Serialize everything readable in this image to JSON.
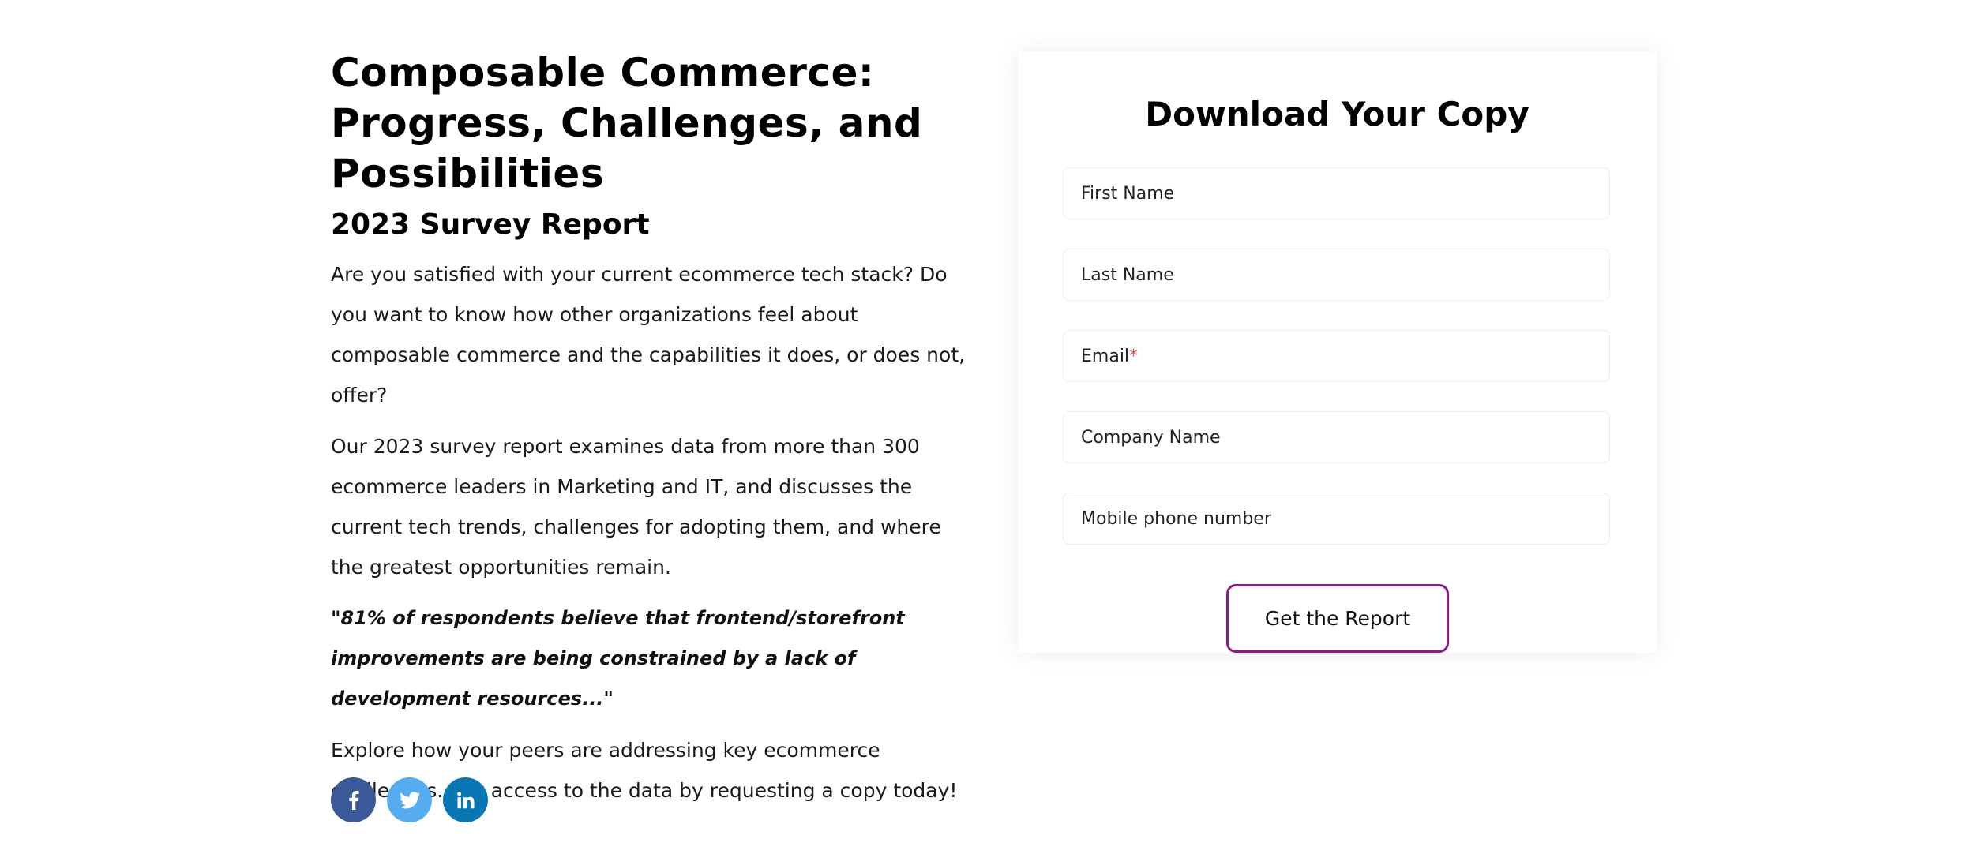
{
  "article": {
    "title": "Composable Commerce: Progress, Challenges, and Possibilities",
    "subtitle": "2023 Survey Report",
    "paragraph_1": "Are you satisfied with your current ecommerce tech stack? Do you want to know how other organizations feel about composable commerce and the capabilities it does, or does not, offer?",
    "paragraph_2": "Our 2023 survey report examines data from more than 300 ecommerce leaders in Marketing and IT, and discusses the current tech trends, challenges for adopting them, and where the greatest opportunities remain.",
    "quote": "\"81% of respondents believe that frontend/storefront improvements are being constrained by a lack of development resources...\"",
    "paragraph_3": "Explore how your peers are addressing key ecommerce challenges. Get access to the data by requesting a copy today!"
  },
  "social": {
    "buttons": [
      {
        "icon": "facebook-icon",
        "color": "#3b5998"
      },
      {
        "icon": "twitter-icon",
        "color": "#55acee"
      },
      {
        "icon": "linkedin-icon",
        "color": "#0a77b5"
      }
    ]
  },
  "form": {
    "title": "Download Your Copy",
    "fields": {
      "first_name": "First Name",
      "last_name": "Last Name",
      "email": "Email",
      "email_required_mark": "*",
      "company_name": "Company Name",
      "mobile_phone": "Mobile phone number"
    },
    "submit_label": "Get the Report",
    "accent_color": "#8a1a8c"
  }
}
